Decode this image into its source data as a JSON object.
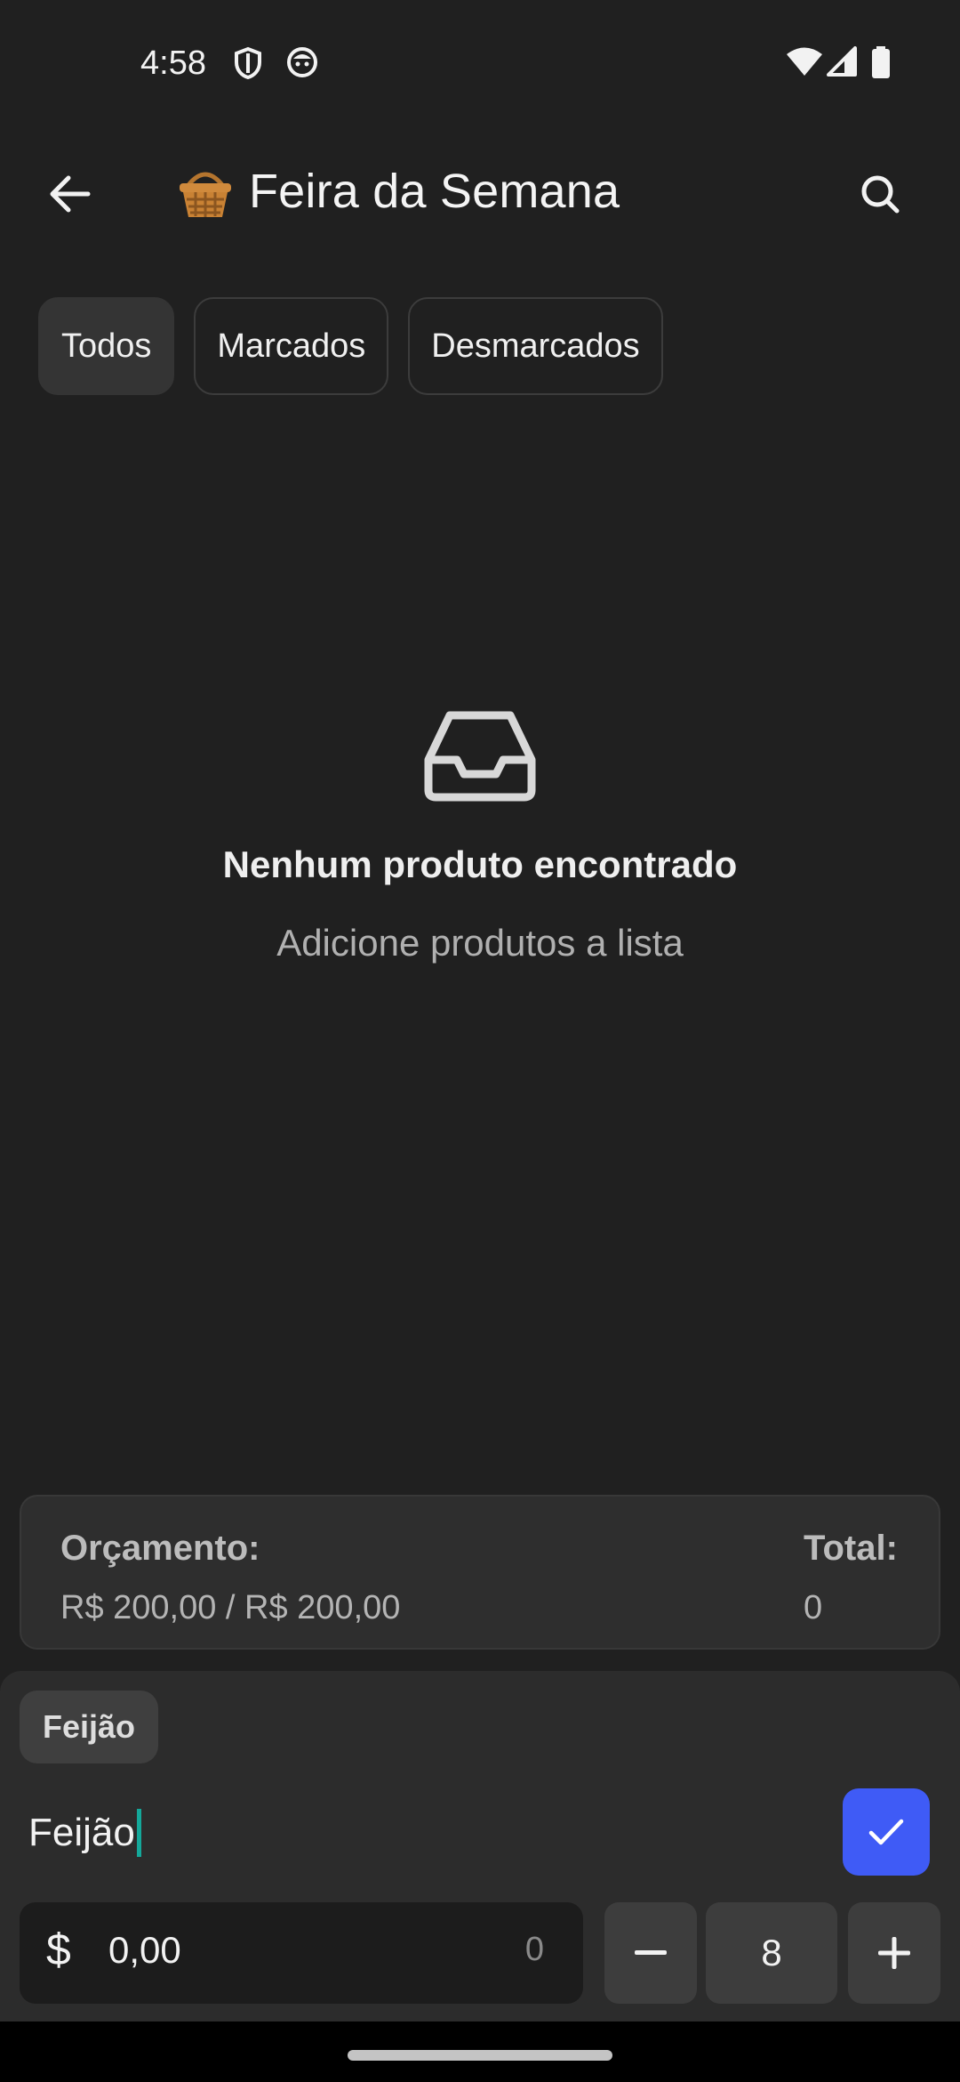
{
  "status_bar": {
    "time": "4:58",
    "icons": [
      "shield-icon",
      "face-icon",
      "wifi-icon",
      "signal-icon",
      "battery-icon"
    ]
  },
  "app_bar": {
    "back_icon": "arrow-left-icon",
    "title_emoji": "basket-icon",
    "title": "Feira da Semana",
    "search_icon": "search-icon"
  },
  "filters": {
    "tabs": [
      {
        "label": "Todos",
        "active": true
      },
      {
        "label": "Marcados",
        "active": false
      },
      {
        "label": "Desmarcados",
        "active": false
      }
    ]
  },
  "empty_state": {
    "icon": "inbox-icon",
    "title": "Nenhum produto encontrado",
    "subtitle": "Adicione produtos a lista"
  },
  "budget": {
    "label": "Orçamento:",
    "value": "R$ 200,00 / R$ 200,00",
    "total_label": "Total:",
    "total_value": "0"
  },
  "add_sheet": {
    "suggestion": "Feijão",
    "name_value": "Feijão",
    "confirm_icon": "check-icon",
    "price_currency": "$",
    "price_value": "0,00",
    "price_hint": "0",
    "quantity": "8",
    "minus_icon": "minus-icon",
    "plus_icon": "plus-icon"
  },
  "colors": {
    "background": "#202020",
    "card": "#2e2e2e",
    "sheet": "#2c2c2c",
    "accent": "#3f5bf6",
    "caret": "#14a89a"
  }
}
